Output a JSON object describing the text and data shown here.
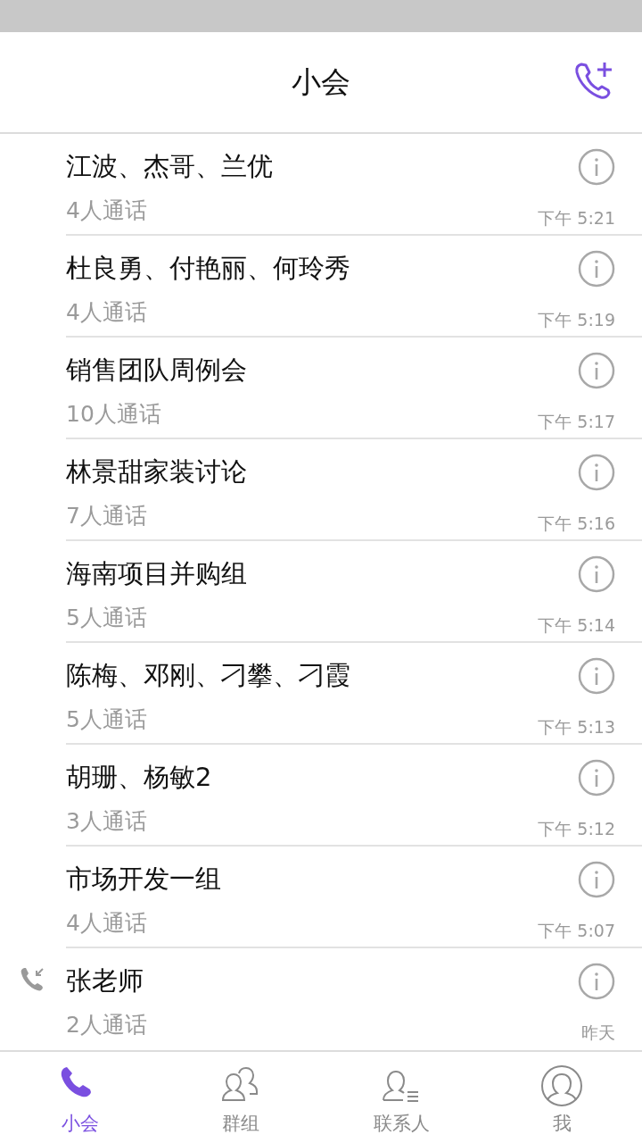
{
  "header": {
    "title": "小会"
  },
  "calls": [
    {
      "title": "江波、杰哥、兰优",
      "subtitle": "4人通话",
      "time": "下午 5:21",
      "incoming": false
    },
    {
      "title": "杜良勇、付艳丽、何玲秀",
      "subtitle": "4人通话",
      "time": "下午 5:19",
      "incoming": false
    },
    {
      "title": "销售团队周例会",
      "subtitle": "10人通话",
      "time": "下午 5:17",
      "incoming": false
    },
    {
      "title": "林景甜家装讨论",
      "subtitle": "7人通话",
      "time": "下午 5:16",
      "incoming": false
    },
    {
      "title": "海南项目并购组",
      "subtitle": "5人通话",
      "time": "下午 5:14",
      "incoming": false
    },
    {
      "title": "陈梅、邓刚、刁攀、刁霞",
      "subtitle": "5人通话",
      "time": "下午 5:13",
      "incoming": false
    },
    {
      "title": "胡珊、杨敏2",
      "subtitle": "3人通话",
      "time": "下午 5:12",
      "incoming": false
    },
    {
      "title": "市场开发一组",
      "subtitle": "4人通话",
      "time": "下午 5:07",
      "incoming": false
    },
    {
      "title": "张老师",
      "subtitle": "2人通话",
      "time": "昨天",
      "incoming": true
    }
  ],
  "tabs": [
    {
      "kind": "phone",
      "label": "小会",
      "selected": true
    },
    {
      "kind": "group",
      "label": "群组",
      "selected": false
    },
    {
      "kind": "contacts",
      "label": "联系人",
      "selected": false
    },
    {
      "kind": "me",
      "label": "我",
      "selected": false
    }
  ]
}
